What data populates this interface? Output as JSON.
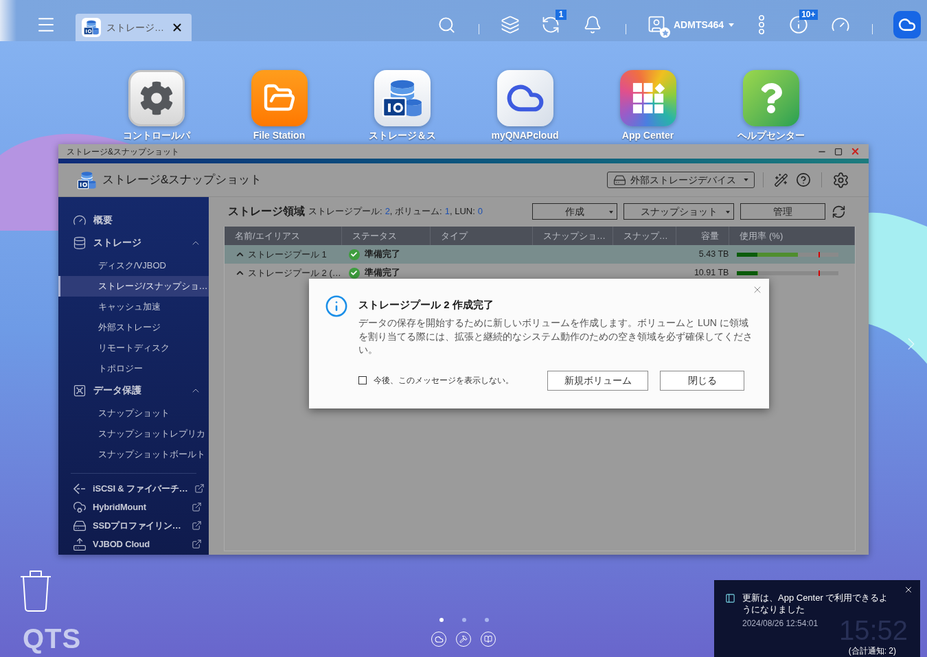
{
  "top_bar": {
    "tabs": [
      {
        "label": "ストレージ…",
        "selected": true
      }
    ],
    "sync_badge": "1",
    "user": {
      "name": "ADMTS464"
    },
    "info_badge": "10+"
  },
  "desktop_icons": [
    {
      "label": "コントロールパ"
    },
    {
      "label": "File Station"
    },
    {
      "label": "ストレージ＆ス"
    },
    {
      "label": "myQNAPcloud"
    },
    {
      "label": "App Center"
    },
    {
      "label": "ヘルプセンター"
    }
  ],
  "window": {
    "title": "ストレージ&スナップショット",
    "app_title": "ストレージ&スナップショット",
    "device_menu": {
      "label": "外部ストレージデバイス"
    }
  },
  "sidebar": {
    "items": [
      {
        "label": "概要",
        "kind": "page",
        "selected": false
      },
      {
        "label": "ストレージ",
        "kind": "group",
        "expanded": true,
        "children": [
          {
            "label": "ディスク/VJBOD",
            "selected": false
          },
          {
            "label": "ストレージ/スナップショ…",
            "selected": true
          },
          {
            "label": "キャッシュ加速",
            "selected": false
          },
          {
            "label": "外部ストレージ",
            "selected": false
          },
          {
            "label": "リモートディスク",
            "selected": false
          },
          {
            "label": "トポロジー",
            "selected": false
          }
        ]
      },
      {
        "label": "データ保護",
        "kind": "group",
        "expanded": true,
        "children": [
          {
            "label": "スナップショット",
            "selected": false
          },
          {
            "label": "スナップショットレプリカ",
            "selected": false
          },
          {
            "label": "スナップショットボールト",
            "selected": false
          }
        ]
      },
      {
        "label": "iSCSI & ファイバーチ…",
        "kind": "external"
      },
      {
        "label": "HybridMount",
        "kind": "external"
      },
      {
        "label": "SSDプロファイリン…",
        "kind": "external"
      },
      {
        "label": "VJBOD Cloud",
        "kind": "external"
      }
    ]
  },
  "storage_area": {
    "title": "ストレージ領域",
    "summary": [
      {
        "label": "ストレージプール:",
        "value": "2"
      },
      {
        "label": ", ボリューム:",
        "value": "1"
      },
      {
        "label": ", LUN:",
        "value": "0"
      }
    ],
    "buttons": [
      {
        "label": "作成",
        "kind": "menu"
      },
      {
        "label": "スナップショット",
        "kind": "menu"
      },
      {
        "label": "管理",
        "kind": "plain"
      }
    ]
  },
  "table": {
    "columns": [
      "名前/エイリアス",
      "ステータス",
      "タイプ",
      "スナップショ…",
      "スナップ…",
      "容量",
      "使用率 (%)"
    ],
    "rows": [
      {
        "name": "ストレージプール 1",
        "expanded": true,
        "status": "準備完了",
        "capacity": "5.43 TB",
        "selected": true,
        "usage": {
          "segments": [
            {
              "level": 0.2,
              "color": "#0b5c0b"
            },
            {
              "level": 0.4,
              "color": "#4f8e2e"
            }
          ],
          "threshold": {
            "level": 0.8
          }
        }
      },
      {
        "name": "ストレージプール 2 (…",
        "expanded": true,
        "status": "準備完了",
        "capacity": "10.91 TB",
        "selected": false,
        "usage": {
          "segments": [
            {
              "level": 0.2,
              "color": "#0b5c0b"
            },
            {
              "level": 0.01,
              "color": "#4f8e2e"
            }
          ],
          "threshold": {
            "level": 0.8
          }
        }
      }
    ]
  },
  "dialog": {
    "title": "ストレージプール 2 作成完了",
    "message": "データの保存を開始するために新しいボリュームを作成します。ボリュームと LUN に領域を割り当てる際には、拡張と継続的なシステム動作のための空き領域を必ず確保してください。",
    "dont_show_again": {
      "label": "今後、このメッセージを表示しない。",
      "checked": false
    },
    "buttons": [
      "新規ボリューム",
      "閉じる"
    ]
  },
  "desktop": {
    "logo": "QTS",
    "pager": [
      {
        "selected": true
      },
      {
        "selected": false
      },
      {
        "selected": false
      }
    ]
  },
  "notification": {
    "message": "更新は、App Center で利用できるようになりました",
    "time": "2024/08/26 12:54:01",
    "total": "(合計通知: 2)"
  },
  "clock": {
    "time": "15:52"
  }
}
